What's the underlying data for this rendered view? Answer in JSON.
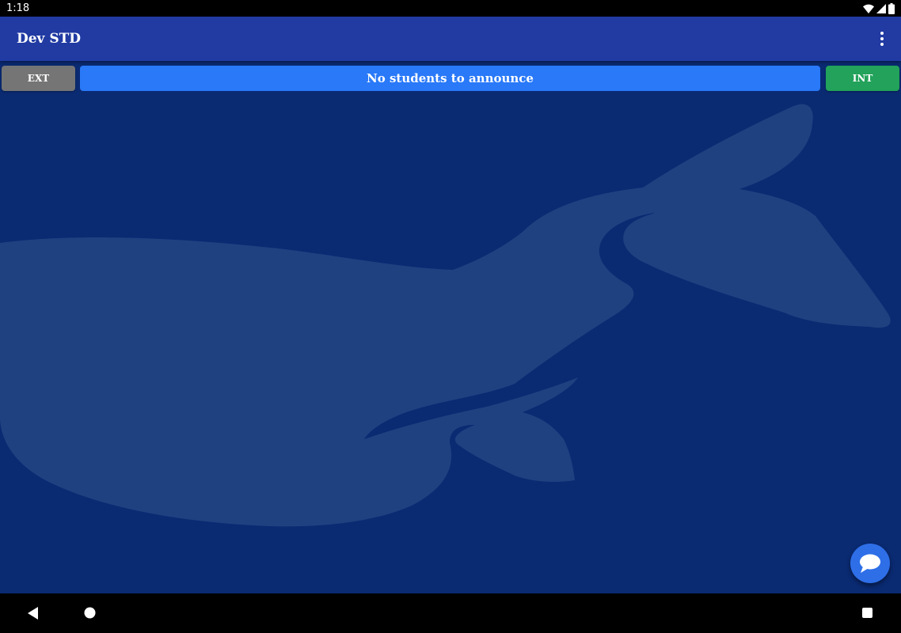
{
  "status_bar": {
    "time": "1:18",
    "icons": [
      "wifi-icon",
      "cellular-icon",
      "battery-icon"
    ]
  },
  "app_bar": {
    "title": "Dev STD",
    "overflow_icon": "more-vert-icon",
    "color": "#213ba3"
  },
  "actions": {
    "ext_label": "EXT",
    "int_label": "INT",
    "announce_text": "No students to announce",
    "ext_color": "#757575",
    "int_color": "#22a25a",
    "announce_color": "#2979f8"
  },
  "background": {
    "color": "#0a2a72",
    "watermark_icon": "whale-logo-icon"
  },
  "fab": {
    "icon": "chat-bubble-icon"
  },
  "nav_bar": {
    "icons": [
      "back-icon",
      "home-icon",
      "recents-icon"
    ]
  }
}
